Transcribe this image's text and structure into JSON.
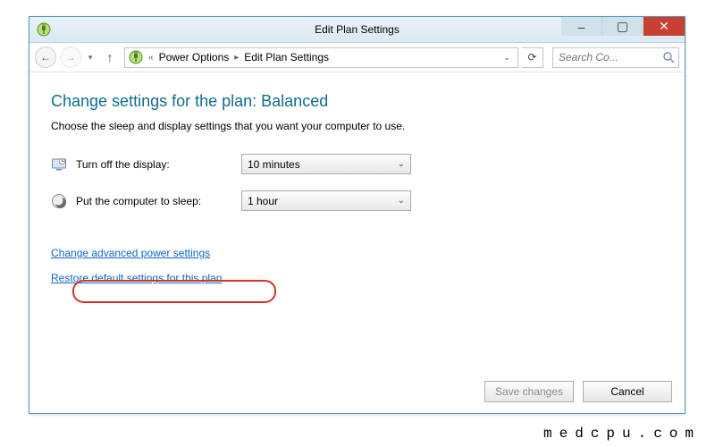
{
  "window": {
    "title": "Edit Plan Settings",
    "controls": {
      "min": "–",
      "max": "▢",
      "close": "✕"
    }
  },
  "nav": {
    "back": "←",
    "forward": "→",
    "recent_dd": "▾",
    "up": "↑",
    "refresh": "⟳",
    "crumb_prefix": "«",
    "crumb1": "Power Options",
    "crumb2": "Edit Plan Settings",
    "crumb_tail_dd": "⌄",
    "search_placeholder": "Search Co..."
  },
  "page": {
    "heading": "Change settings for the plan: Balanced",
    "subtext": "Choose the sleep and display settings that you want your computer to use."
  },
  "settings": {
    "display_off": {
      "label": "Turn off the display:",
      "value": "10 minutes"
    },
    "sleep": {
      "label": "Put the computer to sleep:",
      "value": "1 hour"
    }
  },
  "links": {
    "advanced": "Change advanced power settings",
    "restore": "Restore default settings for this plan"
  },
  "footer": {
    "save": "Save changes",
    "cancel": "Cancel"
  },
  "watermark": "medcpu.com"
}
